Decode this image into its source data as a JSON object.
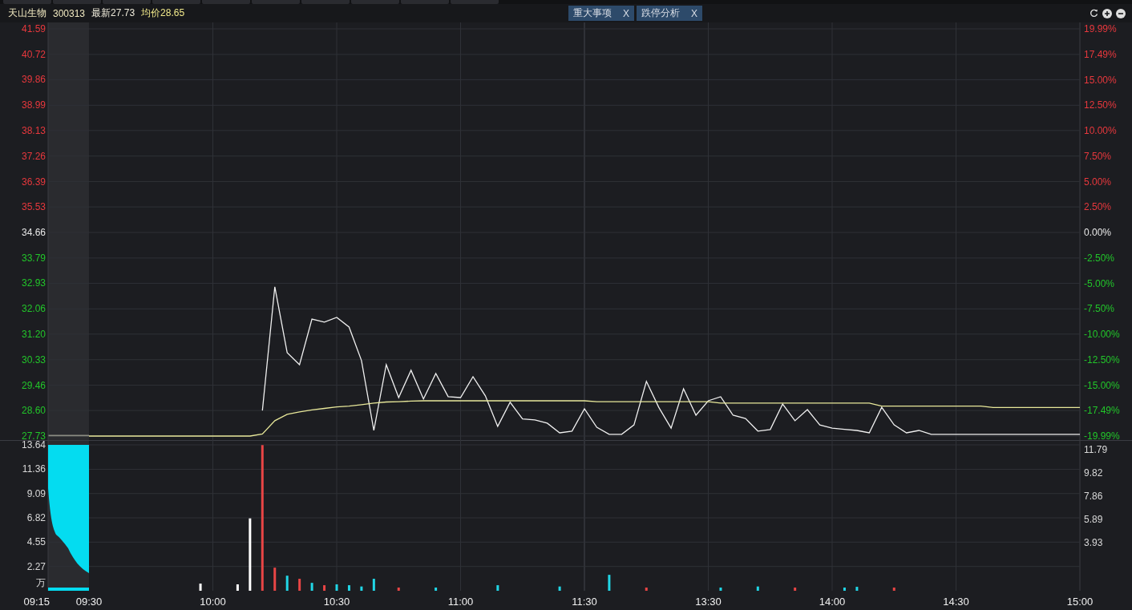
{
  "header": {
    "name": "天山生物",
    "code": "300313",
    "latest": "最新27.73",
    "average": "均价28.65"
  },
  "tabs": [
    {
      "label": "重大事项",
      "close": "X"
    },
    {
      "label": "跌停分析",
      "close": "X"
    }
  ],
  "price_chart": {
    "chart_data": {
      "type": "line",
      "grid": true,
      "ylim": [
        27.73,
        41.59
      ],
      "yticks": [
        {
          "value": 41.59,
          "label": "41.59"
        },
        {
          "value": 40.72,
          "label": "40.72"
        },
        {
          "value": 39.86,
          "label": "39.86"
        },
        {
          "value": 38.99,
          "label": "38.99"
        },
        {
          "value": 38.13,
          "label": "38.13"
        },
        {
          "value": 37.26,
          "label": "37.26"
        },
        {
          "value": 36.39,
          "label": "36.39"
        },
        {
          "value": 35.53,
          "label": "35.53"
        },
        {
          "value": 34.66,
          "label": "34.66"
        },
        {
          "value": 33.79,
          "label": "33.79"
        },
        {
          "value": 32.93,
          "label": "32.93"
        },
        {
          "value": 32.06,
          "label": "32.06"
        },
        {
          "value": 31.2,
          "label": "31.20"
        },
        {
          "value": 30.33,
          "label": "30.33"
        },
        {
          "value": 29.46,
          "label": "29.46"
        },
        {
          "value": 28.6,
          "label": "28.60"
        },
        {
          "value": 27.73,
          "label": "27.73"
        }
      ],
      "categories": [
        null,
        null,
        null,
        null,
        null,
        null,
        null,
        null,
        null,
        null,
        null,
        null,
        null,
        null,
        null,
        null,
        null,
        null,
        null,
        null,
        null,
        null,
        null,
        null,
        null,
        null,
        null,
        null,
        null,
        null,
        null,
        null,
        null,
        null,
        null,
        null,
        null,
        null,
        null,
        null,
        null,
        null,
        null,
        null,
        null,
        null,
        null,
        null,
        null,
        null,
        null,
        null,
        null,
        null,
        null,
        null,
        null,
        null,
        null,
        null,
        null,
        null,
        null,
        null,
        null,
        null,
        null,
        null,
        null,
        null,
        null,
        null,
        null,
        null,
        null,
        null,
        null,
        null,
        null,
        null,
        null
      ],
      "series": [
        {
          "color": "#f0f0f0",
          "values": [
            null,
            null,
            null,
            null,
            null,
            null,
            null,
            null,
            null,
            null,
            null,
            null,
            null,
            null,
            28.6,
            32.81,
            30.57,
            30.16,
            31.71,
            31.61,
            31.77,
            31.44,
            30.3,
            27.92,
            30.16,
            29.04,
            29.97,
            28.99,
            29.86,
            29.07,
            29.04,
            29.75,
            29.1,
            28.06,
            28.88,
            28.31,
            28.28,
            28.17,
            27.84,
            27.9,
            28.66,
            28.03,
            27.79,
            27.79,
            28.11,
            29.59,
            28.71,
            28.0,
            29.34,
            28.44,
            28.93,
            29.07,
            28.44,
            28.33,
            27.9,
            27.95,
            28.82,
            28.25,
            28.63,
            28.11,
            28.0,
            27.96,
            27.92,
            27.84,
            28.71,
            28.11,
            27.84,
            27.92,
            27.79,
            27.79,
            27.79,
            27.79,
            27.79,
            27.79,
            27.79,
            27.79,
            27.79,
            27.79,
            27.79,
            27.79,
            27.79
          ]
        },
        {
          "color": "#e8e89a",
          "values": [
            27.73,
            27.73,
            27.73,
            27.73,
            27.73,
            27.73,
            27.73,
            27.73,
            27.73,
            27.73,
            27.73,
            27.73,
            27.73,
            27.73,
            27.8,
            28.25,
            28.47,
            28.55,
            28.62,
            28.67,
            28.72,
            28.75,
            28.8,
            28.85,
            28.89,
            28.9,
            28.92,
            28.93,
            28.93,
            28.93,
            28.93,
            28.93,
            28.93,
            28.93,
            28.93,
            28.93,
            28.93,
            28.93,
            28.93,
            28.93,
            28.93,
            28.9,
            28.9,
            28.9,
            28.9,
            28.9,
            28.9,
            28.9,
            28.9,
            28.9,
            28.9,
            28.85,
            28.85,
            28.85,
            28.85,
            28.85,
            28.85,
            28.85,
            28.85,
            28.85,
            28.85,
            28.85,
            28.85,
            28.85,
            28.75,
            28.75,
            28.75,
            28.75,
            28.75,
            28.75,
            28.75,
            28.75,
            28.75,
            28.7,
            28.7,
            28.7,
            28.7,
            28.7,
            28.7,
            28.7,
            28.7
          ]
        }
      ]
    },
    "right_axis": [
      {
        "text": "19.99%",
        "kind": "up"
      },
      {
        "text": "17.49%",
        "kind": "up"
      },
      {
        "text": "15.00%",
        "kind": "up"
      },
      {
        "text": "12.50%",
        "kind": "up"
      },
      {
        "text": "10.00%",
        "kind": "up"
      },
      {
        "text": "7.50%",
        "kind": "up"
      },
      {
        "text": "5.00%",
        "kind": "up"
      },
      {
        "text": "2.50%",
        "kind": "up"
      },
      {
        "text": "0.00%",
        "kind": "flat"
      },
      {
        "text": "-2.50%",
        "kind": "down"
      },
      {
        "text": "-5.00%",
        "kind": "down"
      },
      {
        "text": "-7.50%",
        "kind": "down"
      },
      {
        "text": "-10.00%",
        "kind": "down"
      },
      {
        "text": "-12.50%",
        "kind": "down"
      },
      {
        "text": "-15.00%",
        "kind": "down"
      },
      {
        "text": "-17.49%",
        "kind": "down"
      },
      {
        "text": "-19.99%",
        "kind": "down"
      }
    ]
  },
  "volume_chart": {
    "unit": "万",
    "pre_market_label": "09:15",
    "chart_data": {
      "type": "bar",
      "grid": true,
      "ylim": [
        0,
        13.64
      ],
      "yticks": [
        {
          "value": 13.64,
          "label": "13.64"
        },
        {
          "value": 11.36,
          "label": "11.36"
        },
        {
          "value": 9.09,
          "label": "9.09"
        },
        {
          "value": 6.82,
          "label": "6.82"
        },
        {
          "value": 4.55,
          "label": "4.55"
        },
        {
          "value": 2.27,
          "label": "2.27"
        }
      ],
      "categories": [
        "09:30",
        null,
        null,
        null,
        null,
        null,
        null,
        null,
        null,
        null,
        "10:00",
        null,
        null,
        null,
        null,
        null,
        null,
        null,
        null,
        null,
        "10:30",
        null,
        null,
        null,
        null,
        null,
        null,
        null,
        null,
        null,
        "11:00",
        null,
        null,
        null,
        null,
        null,
        null,
        null,
        null,
        null,
        "11:30",
        null,
        null,
        null,
        null,
        null,
        null,
        null,
        null,
        null,
        "13:30",
        null,
        null,
        null,
        null,
        null,
        null,
        null,
        null,
        null,
        "14:00",
        null,
        null,
        null,
        null,
        null,
        null,
        null,
        null,
        null,
        "14:30",
        null,
        null,
        null,
        null,
        null,
        null,
        null,
        null,
        null,
        "15:00"
      ],
      "series": [
        {
          "color": "#e84545",
          "values": [
            null,
            null,
            null,
            null,
            null,
            null,
            null,
            null,
            null,
            null,
            null,
            null,
            null,
            null,
            13.62,
            2.16,
            null,
            1.12,
            null,
            0.52,
            null,
            null,
            null,
            null,
            null,
            0.3,
            null,
            null,
            null,
            null,
            null,
            null,
            null,
            null,
            null,
            null,
            null,
            null,
            null,
            null,
            null,
            null,
            null,
            null,
            null,
            0.3,
            null,
            null,
            null,
            null,
            null,
            null,
            null,
            null,
            null,
            null,
            null,
            0.3,
            null,
            null,
            null,
            null,
            null,
            null,
            null,
            0.3,
            null,
            null,
            null,
            null,
            null,
            null,
            null,
            null,
            null,
            null,
            null,
            null,
            null,
            null,
            null
          ]
        },
        {
          "color": "#ffffff",
          "values": [
            null,
            null,
            null,
            null,
            null,
            null,
            null,
            null,
            null,
            0.67,
            null,
            null,
            0.6,
            6.77,
            null,
            null,
            null,
            null,
            null,
            null,
            null,
            null,
            null,
            null,
            null,
            null,
            null,
            null,
            null,
            null,
            null,
            null,
            null,
            null,
            null,
            null,
            null,
            null,
            null,
            null,
            null,
            null,
            null,
            null,
            null,
            null,
            null,
            null,
            null,
            null,
            null,
            null,
            null,
            null,
            null,
            null,
            null,
            null,
            null,
            null,
            null,
            null,
            null,
            null,
            null,
            null,
            null,
            null,
            null,
            null,
            null,
            null,
            null,
            null,
            null,
            null,
            null,
            null,
            null,
            null,
            null
          ]
        },
        {
          "color": "#21d6e6",
          "values": [
            null,
            null,
            null,
            null,
            null,
            null,
            null,
            null,
            null,
            null,
            null,
            null,
            null,
            null,
            null,
            null,
            1.41,
            null,
            0.74,
            null,
            0.6,
            0.52,
            0.4,
            1.12,
            null,
            null,
            null,
            null,
            0.3,
            null,
            null,
            null,
            null,
            0.52,
            null,
            null,
            null,
            null,
            0.4,
            null,
            null,
            null,
            1.49,
            null,
            null,
            null,
            null,
            null,
            null,
            null,
            null,
            0.3,
            null,
            null,
            0.4,
            null,
            null,
            null,
            null,
            null,
            null,
            0.3,
            0.37,
            null,
            null,
            null,
            null,
            null,
            null,
            null,
            null,
            null,
            null,
            null,
            null,
            null,
            null,
            null,
            null,
            null,
            null
          ]
        }
      ]
    },
    "right_axis": [
      "11.79",
      "9.82",
      "7.86",
      "5.89",
      "3.93"
    ]
  }
}
